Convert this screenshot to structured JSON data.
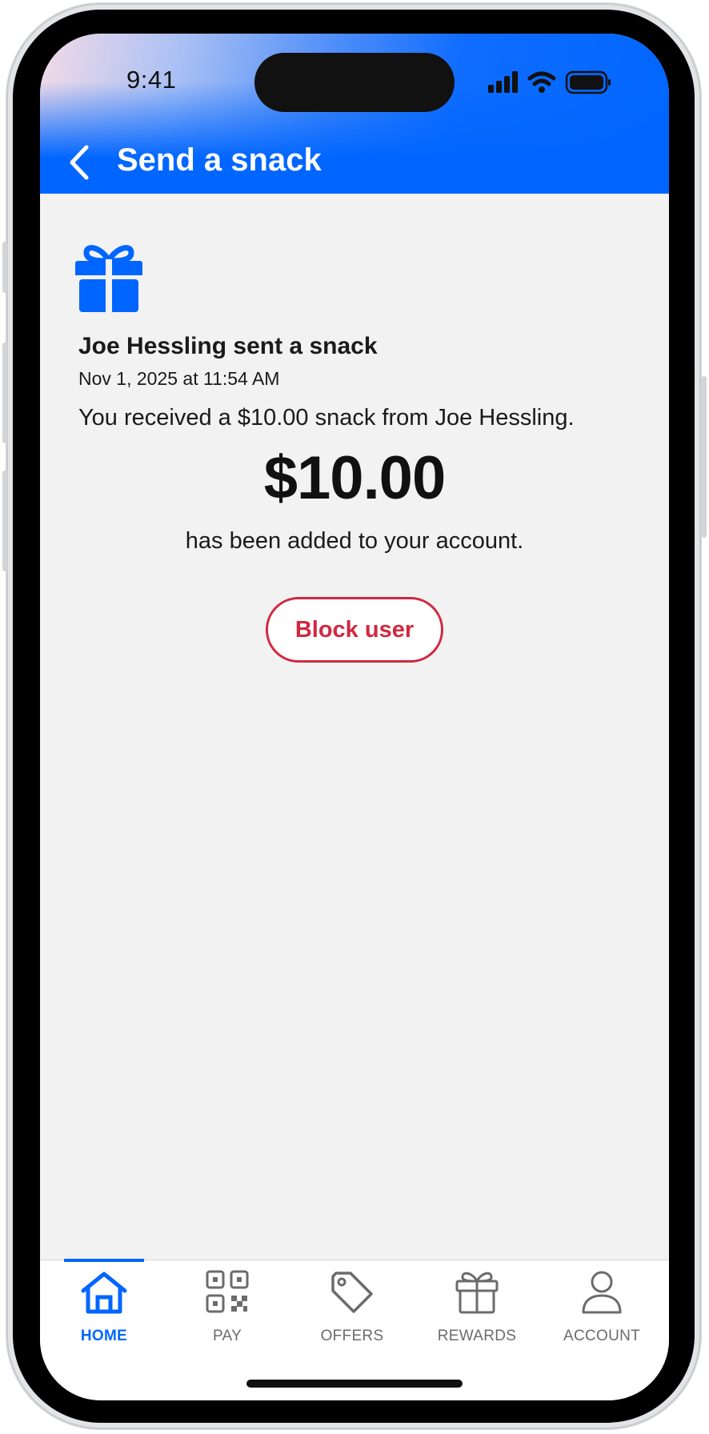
{
  "status_bar": {
    "time": "9:41"
  },
  "header": {
    "title": "Send a snack"
  },
  "event": {
    "title": "Joe Hessling sent a snack",
    "date": "Nov 1, 2025 at 11:54 AM",
    "description": "You received a $10.00 snack from Joe Hessling.",
    "amount": "$10.00",
    "added_text": "has been added to your account.",
    "block_label": "Block user"
  },
  "tabbar": {
    "active": "home",
    "tabs": [
      {
        "label": "HOME",
        "icon": "home-icon"
      },
      {
        "label": "PAY",
        "icon": "qr-code-icon"
      },
      {
        "label": "OFFERS",
        "icon": "tag-icon"
      },
      {
        "label": "REWARDS",
        "icon": "gift-icon"
      },
      {
        "label": "ACCOUNT",
        "icon": "person-icon"
      }
    ]
  },
  "colors": {
    "accent": "#0066ff",
    "danger": "#d12840",
    "background": "#f2f2f2"
  }
}
